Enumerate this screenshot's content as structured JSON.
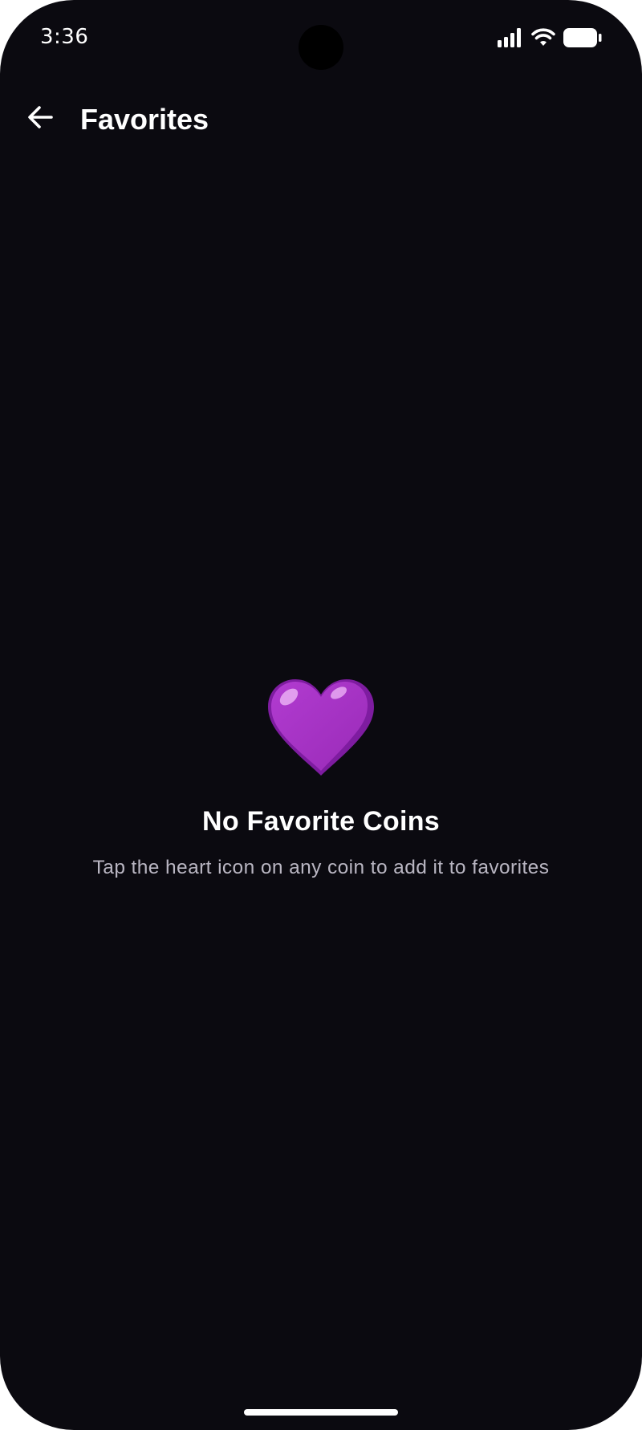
{
  "status_bar": {
    "time": "3:36",
    "icons": [
      "signal-icon",
      "wifi-icon",
      "battery-icon"
    ]
  },
  "app_bar": {
    "back_icon": "arrow-left-icon",
    "title": "Favorites"
  },
  "empty_state": {
    "icon": "purple-heart-icon",
    "title": "No Favorite Coins",
    "subtitle": "Tap the heart icon on any coin to add it to favorites"
  },
  "colors": {
    "background": "#0b0a10",
    "text_primary": "#ffffff",
    "text_secondary": "#b9b6c2",
    "heart": "#a030c0"
  }
}
